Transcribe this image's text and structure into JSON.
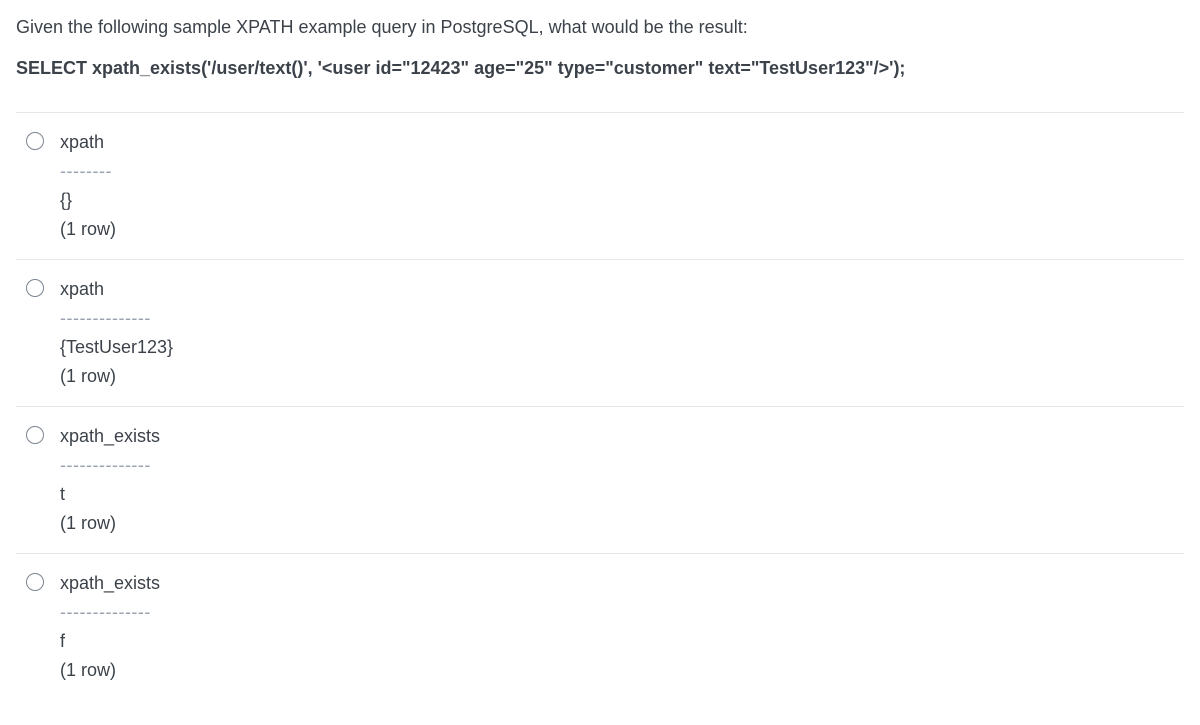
{
  "question": {
    "text": "Given the following sample XPATH example query in PostgreSQL, what would be the result:",
    "code": "SELECT xpath_exists('/user/text()', '<user id=\"12423\"  age=\"25\"  type=\"customer\" text=\"TestUser123\"/>');"
  },
  "options": [
    {
      "header": "xpath",
      "dashes": "--------",
      "value": "{}",
      "rowcount": "(1 row)"
    },
    {
      "header": "xpath",
      "dashes": "--------------",
      "value": "{TestUser123}",
      "rowcount": "(1 row)"
    },
    {
      "header": "xpath_exists",
      "dashes": "--------------",
      "value": "t",
      "rowcount": "(1 row)"
    },
    {
      "header": "xpath_exists",
      "dashes": "--------------",
      "value": "f",
      "rowcount": "(1 row)"
    }
  ]
}
